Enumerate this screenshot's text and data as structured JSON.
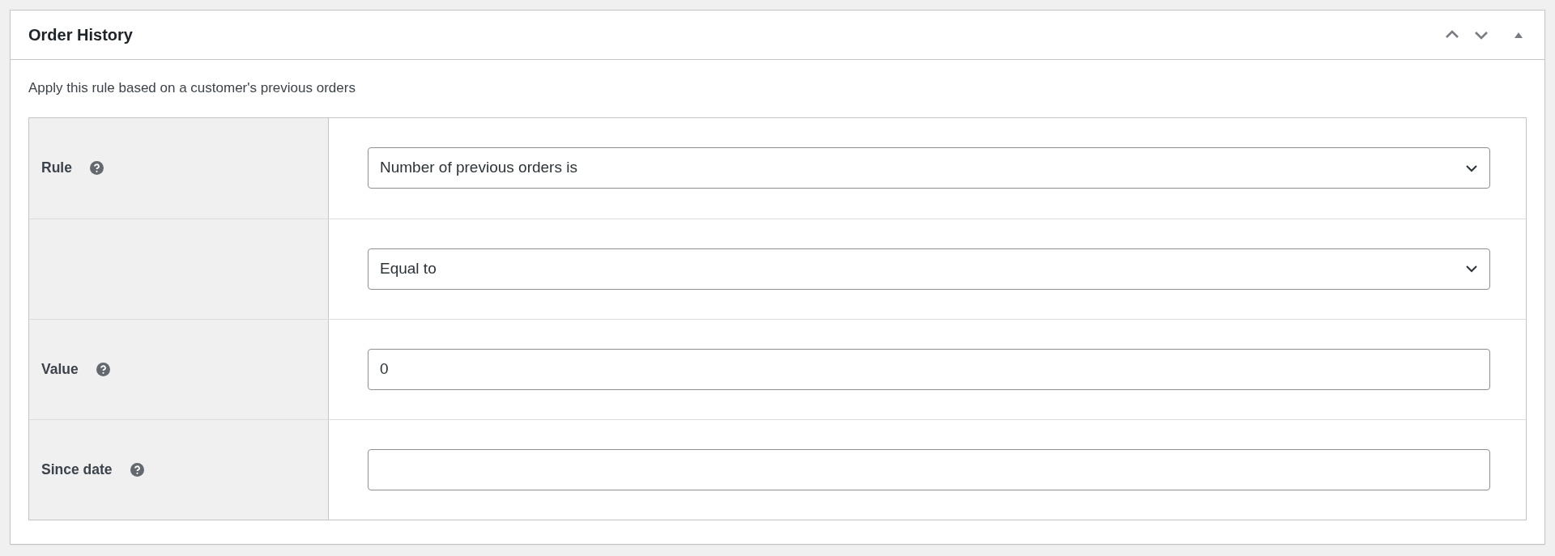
{
  "panel": {
    "title": "Order History",
    "controls": [
      {
        "kind": "up"
      },
      {
        "kind": "down"
      },
      {
        "kind": "toggle"
      }
    ]
  },
  "description": "Apply this rule based on a customer's previous orders",
  "rows": [
    {
      "label": "Rule",
      "help": true,
      "kind": "select",
      "value": "Number of previous orders is"
    },
    {
      "help": false,
      "kind": "select",
      "value": "Equal to"
    },
    {
      "label": "Value",
      "help": true,
      "kind": "text",
      "value": "0"
    },
    {
      "label": "Since date",
      "help": true,
      "kind": "text"
    }
  ]
}
